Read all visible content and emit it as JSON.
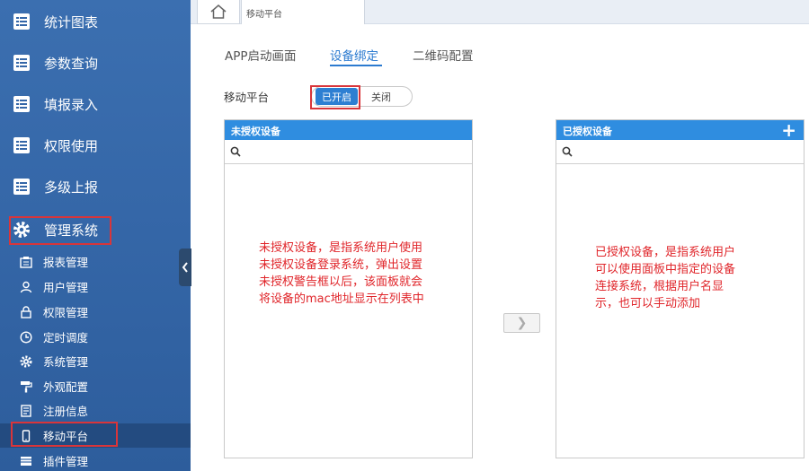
{
  "sidebar": {
    "main_items": [
      {
        "label": "统计图表",
        "icon": "list-doc-icon"
      },
      {
        "label": "参数查询",
        "icon": "list-doc-icon"
      },
      {
        "label": "填报录入",
        "icon": "list-doc-icon"
      },
      {
        "label": "权限使用",
        "icon": "list-doc-icon"
      },
      {
        "label": "多级上报",
        "icon": "list-doc-icon"
      },
      {
        "label": "管理系统",
        "icon": "gear-icon"
      }
    ],
    "sub_items": [
      {
        "label": "报表管理",
        "icon": "report-icon"
      },
      {
        "label": "用户管理",
        "icon": "user-icon"
      },
      {
        "label": "权限管理",
        "icon": "lock-icon"
      },
      {
        "label": "定时调度",
        "icon": "clock-icon"
      },
      {
        "label": "系统管理",
        "icon": "gear-icon"
      },
      {
        "label": "外观配置",
        "icon": "paint-roller-icon"
      },
      {
        "label": "注册信息",
        "icon": "register-icon"
      },
      {
        "label": "移动平台",
        "icon": "mobile-icon"
      },
      {
        "label": "插件管理",
        "icon": "plugin-icon"
      }
    ]
  },
  "topbar": {
    "page_tab": "移动平台"
  },
  "subtabs": [
    {
      "label": "APP启动画面",
      "active": false
    },
    {
      "label": "设备绑定",
      "active": true
    },
    {
      "label": "二维码配置",
      "active": false
    }
  ],
  "platform": {
    "label": "移动平台",
    "on_label": "已开启",
    "off_label": "关闭"
  },
  "left_panel": {
    "title": "未授权设备",
    "search_placeholder": "",
    "annotation": [
      "未授权设备，是指系统用户使用",
      "未授权设备登录系统，弹出设置",
      "未授权警告框以后，该面板就会",
      "将设备的mac地址显示在列表中"
    ]
  },
  "right_panel": {
    "title": "已授权设备",
    "search_placeholder": "",
    "add_label": "+",
    "annotation": [
      "已授权设备，是指系统用户",
      "可以使用面板中指定的设备",
      "连接系统，根据用户名显",
      "示，也可以手动添加"
    ]
  },
  "move_button_label": "❯",
  "colors": {
    "sidebar_bg": "#3567a8",
    "accent": "#2c7bd0",
    "panel_header": "#2f8de0",
    "highlight_border": "#d9353a",
    "annotation_text": "#e0252a"
  }
}
